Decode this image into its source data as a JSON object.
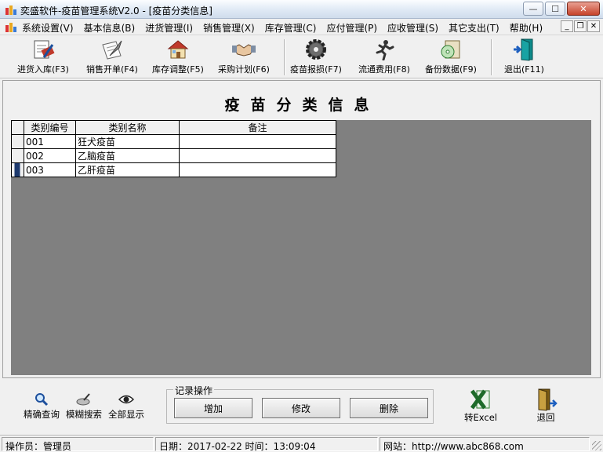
{
  "window": {
    "title": "奕盛软件-疫苗管理系统V2.0 - [疫苗分类信息]",
    "controls": {
      "minimize": "—",
      "maximize": "☐",
      "close": "✕"
    }
  },
  "menubar": {
    "items": [
      "系统设置(V)",
      "基本信息(B)",
      "进货管理(I)",
      "销售管理(X)",
      "库存管理(C)",
      "应付管理(P)",
      "应收管理(S)",
      "其它支出(T)",
      "帮助(H)"
    ],
    "mdi_controls": {
      "minimize": "_",
      "restore": "❐",
      "close": "✕"
    }
  },
  "toolbar": {
    "buttons": [
      {
        "label": "进货入库(F3)",
        "icon": "document-pen-icon"
      },
      {
        "label": "销售开单(F4)",
        "icon": "quill-paper-icon"
      },
      {
        "label": "库存调整(F5)",
        "icon": "house-icon"
      },
      {
        "label": "采购计划(F6)",
        "icon": "handshake-icon"
      },
      {
        "label": "疫苗报损(F7)",
        "icon": "gear-icon"
      },
      {
        "label": "流通费用(F8)",
        "icon": "runner-icon"
      },
      {
        "label": "备份数据(F9)",
        "icon": "backup-disc-icon"
      },
      {
        "label": "退出(F11)",
        "icon": "exit-door-icon"
      }
    ]
  },
  "page": {
    "title": "疫苗分类信息"
  },
  "grid": {
    "columns": [
      "类别编号",
      "类别名称",
      "备注"
    ],
    "rows": [
      {
        "code": "001",
        "name": "狂犬疫苗",
        "note": ""
      },
      {
        "code": "002",
        "name": "乙脑疫苗",
        "note": ""
      },
      {
        "code": "003",
        "name": "乙肝疫苗",
        "note": ""
      }
    ],
    "current_row": 3
  },
  "bottom": {
    "query_buttons": [
      {
        "label": "精确查询",
        "icon": "magnifier-icon"
      },
      {
        "label": "模糊搜索",
        "icon": "blur-search-icon"
      },
      {
        "label": "全部显示",
        "icon": "eye-icon"
      }
    ],
    "record_group": {
      "title": "记录操作",
      "add": "增加",
      "edit": "修改",
      "delete": "删除"
    },
    "excel_label": "转Excel",
    "back_label": "退回"
  },
  "statusbar": {
    "operator": "操作员：管理员",
    "datetime": "日期：2017-02-22 时间：13:09:04",
    "website": "网站：http://www.abc868.com"
  },
  "colors": {
    "grid_background": "#808080",
    "current_row_marker": "#1e3a6e"
  }
}
